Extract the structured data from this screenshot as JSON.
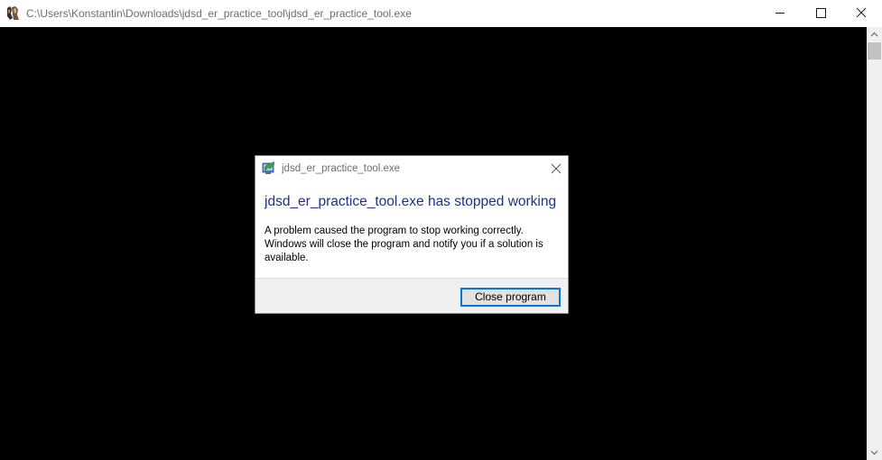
{
  "window": {
    "title": "C:\\Users\\Konstantin\\Downloads\\jdsd_er_practice_tool\\jdsd_er_practice_tool.exe",
    "icon": "game-app-icon",
    "controls": [
      "minimize-icon",
      "maximize-icon",
      "close-icon"
    ]
  },
  "console": {
    "background": "#000000"
  },
  "dialog": {
    "title": "jdsd_er_practice_tool.exe",
    "icon": "windows-error-reporting-icon",
    "heading": "jdsd_er_practice_tool.exe has stopped working",
    "message": "A problem caused the program to stop working correctly. Windows will close the program and notify you if a solution is available.",
    "button_label": "Close program",
    "heading_color": "#1e3287",
    "accent": "#0078d7"
  }
}
